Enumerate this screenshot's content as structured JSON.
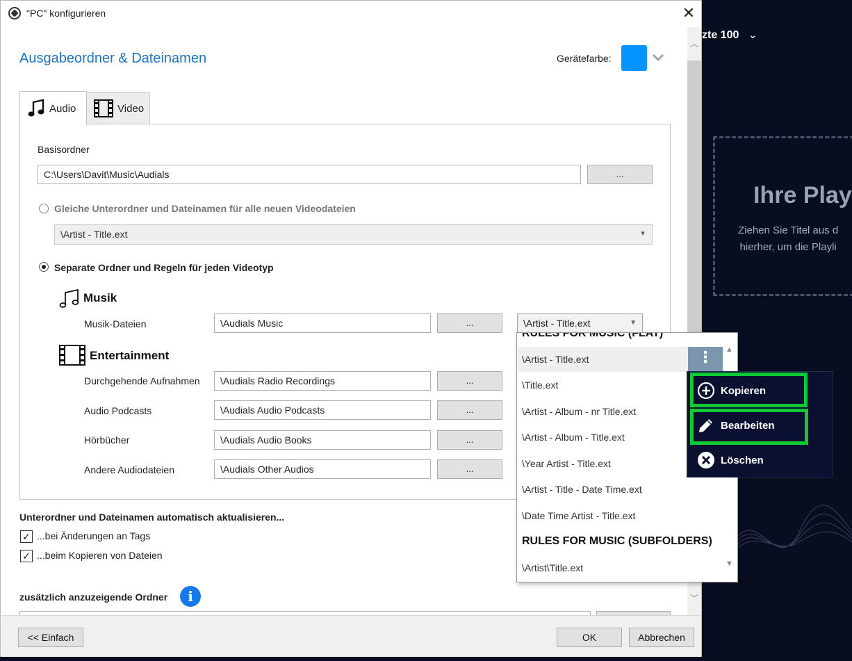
{
  "background_app": {
    "header": "zte 100",
    "header_chevron": "⌄",
    "drop_title": "Ihre Play",
    "drop_hint_line1": "Ziehen Sie Titel aus d",
    "drop_hint_line2": "hierher, um die Playli"
  },
  "dialog": {
    "title": "\"PC\" konfigurieren",
    "close": "✕",
    "section_title": "Ausgabeordner & Dateinamen",
    "device_color_label": "Gerätefarbe:",
    "device_color": "#0593ff",
    "tabs": [
      {
        "label": "Audio",
        "icon": "music-note-icon",
        "selected": true
      },
      {
        "label": "Video",
        "icon": "film-icon",
        "selected": false
      }
    ],
    "base_folder": {
      "label": "Basisordner",
      "value": "C:\\Users\\Davit\\Music\\Audials",
      "browse": "..."
    },
    "option_same": {
      "label": "Gleiche Unterordner und Dateinamen für alle neuen Videodateien",
      "selected": false,
      "combo_value": "\\Artist - Title.ext"
    },
    "option_separate": {
      "label": "Separate Ordner und Regeln für jeden Videotyp",
      "selected": true
    },
    "music": {
      "title": "Musik",
      "rows": [
        {
          "label": "Musik-Dateien",
          "value": "\\Audials Music",
          "browse": "...",
          "rule": "\\Artist - Title.ext"
        }
      ]
    },
    "entertainment": {
      "title": "Entertainment",
      "rows": [
        {
          "label": "Durchgehende Aufnahmen",
          "value": "\\Audials Radio Recordings",
          "browse": "..."
        },
        {
          "label": "Audio Podcasts",
          "value": "\\Audials Audio Podcasts",
          "browse": "..."
        },
        {
          "label": "Hörbücher",
          "value": "\\Audials Audio Books",
          "browse": "..."
        },
        {
          "label": "Andere Audiodateien",
          "value": "\\Audials Other Audios",
          "browse": "..."
        }
      ]
    },
    "auto_update": {
      "label": "Unterordner und Dateinamen automatisch aktualisieren...",
      "on_tag_change": {
        "label": "...bei Änderungen an Tags",
        "checked": true
      },
      "on_copy": {
        "label": "...beim Kopieren von Dateien",
        "checked": true
      }
    },
    "extra_folders_label": "zusätzlich anzuzeigende Ordner",
    "info_glyph": "i",
    "footer": {
      "simple": "<< Einfach",
      "ok": "OK",
      "cancel": "Abbrechen"
    }
  },
  "rule_dropdown": {
    "header_flat": "RULES FOR MUSIC (FLAT)",
    "options_flat": [
      "\\Artist - Title.ext",
      "\\Title.ext",
      "\\Artist - Album - nr Title.ext",
      "\\Artist - Album - Title.ext",
      "\\Year Artist - Title.ext",
      "\\Artist - Title - Date Time.ext",
      "\\Date Time Artist - Title.ext"
    ],
    "header_subfolders": "RULES FOR MUSIC (SUBFOLDERS)",
    "options_subfolders": [
      "\\Artist\\Title.ext"
    ],
    "kebab": "⋮"
  },
  "context_menu": {
    "items": [
      {
        "label": "Kopieren",
        "icon": "plus-circle-icon",
        "highlighted": true
      },
      {
        "label": "Bearbeiten",
        "icon": "pencil-icon",
        "highlighted": true
      },
      {
        "label": "Löschen",
        "icon": "x-circle-icon",
        "highlighted": false
      }
    ],
    "highlight_color": "#12c935"
  }
}
